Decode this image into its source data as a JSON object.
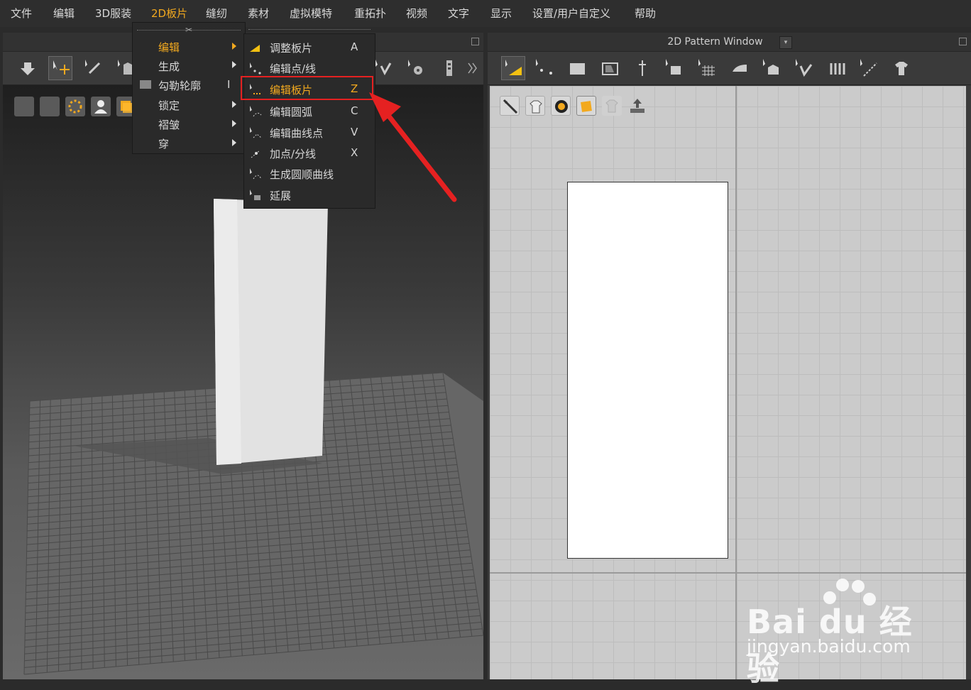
{
  "menubar": {
    "items": [
      "文件",
      "编辑",
      "3D服装",
      "2D板片",
      "缝纫",
      "素材",
      "虚拟模特",
      "重拓扑",
      "视频",
      "文字",
      "显示",
      "设置/用户自定义",
      "帮助"
    ],
    "active_index": 3
  },
  "pattern_window": {
    "title": "2D Pattern Window"
  },
  "menu_2d": {
    "items": [
      {
        "label": "编辑",
        "has_submenu": true,
        "highlighted": true
      },
      {
        "label": "生成",
        "has_submenu": true
      },
      {
        "label": "勾勒轮廓",
        "shortcut": "I"
      },
      {
        "label": "锁定",
        "has_submenu": true
      },
      {
        "label": "褶皱",
        "has_submenu": true
      },
      {
        "label": "穿",
        "has_submenu": true
      }
    ]
  },
  "submenu_edit": {
    "items": [
      {
        "label": "调整板片",
        "shortcut": "A",
        "icon": "adjust-pattern-icon"
      },
      {
        "label": "编辑点/线",
        "shortcut": "",
        "icon": "edit-point-line-icon"
      },
      {
        "label": "编辑板片",
        "shortcut": "Z",
        "icon": "edit-pattern-icon",
        "highlighted": true
      },
      {
        "label": "编辑圆弧",
        "shortcut": "C",
        "icon": "edit-arc-icon"
      },
      {
        "label": "编辑曲线点",
        "shortcut": "V",
        "icon": "edit-curve-point-icon"
      },
      {
        "label": "加点/分线",
        "shortcut": "X",
        "icon": "add-point-icon"
      },
      {
        "label": "生成圆顺曲线",
        "shortcut": "",
        "icon": "smooth-curve-icon"
      },
      {
        "label": "延展",
        "shortcut": "",
        "icon": "extend-icon"
      }
    ]
  },
  "watermark": {
    "brand": "Bai du 经验",
    "url": "jingyan.baidu.com"
  },
  "colors": {
    "accent": "#f2a91f",
    "highlight_box": "#e52121",
    "arrow": "#e52121"
  }
}
